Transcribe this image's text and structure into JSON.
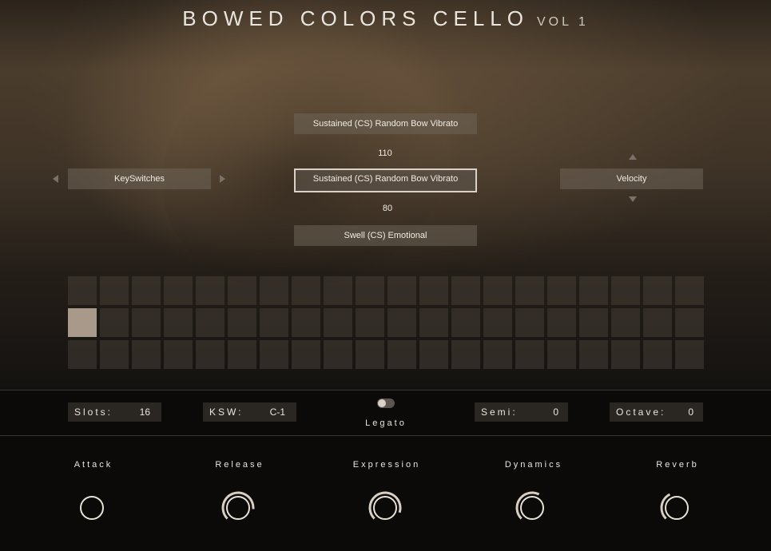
{
  "title": {
    "main": "BOWED COLORS CELLO",
    "sub": "VOL 1"
  },
  "articulations": {
    "top": "Sustained (CS) Random Bow Vibrato",
    "top_value": "110",
    "selected": "Sustained (CS) Random Bow Vibrato",
    "bottom_value": "80",
    "bottom": "Swell (CS) Emotional"
  },
  "left_selector": {
    "label": "KeySwitches"
  },
  "right_selector": {
    "label": "Velocity"
  },
  "slot_grid": {
    "rows": 3,
    "cols": 20,
    "active_cell": {
      "row": 2,
      "col": 1
    }
  },
  "controls": {
    "slots": {
      "label": "Slots:",
      "value": "16"
    },
    "ksw": {
      "label": "KSW:",
      "value": "C-1"
    },
    "legato": {
      "label": "Legato",
      "on": false
    },
    "semi": {
      "label": "Semi:",
      "value": "0"
    },
    "octave": {
      "label": "Octave:",
      "value": "0"
    }
  },
  "knobs": [
    {
      "label": "Attack",
      "level": 0.0
    },
    {
      "label": "Release",
      "level": 0.85
    },
    {
      "label": "Expression",
      "level": 0.9
    },
    {
      "label": "Dynamics",
      "level": 0.6
    },
    {
      "label": "Reverb",
      "level": 0.4
    }
  ],
  "colors": {
    "accent": "#d8d2c8",
    "panel": "#2a2622",
    "active_cell": "#a8998a"
  }
}
